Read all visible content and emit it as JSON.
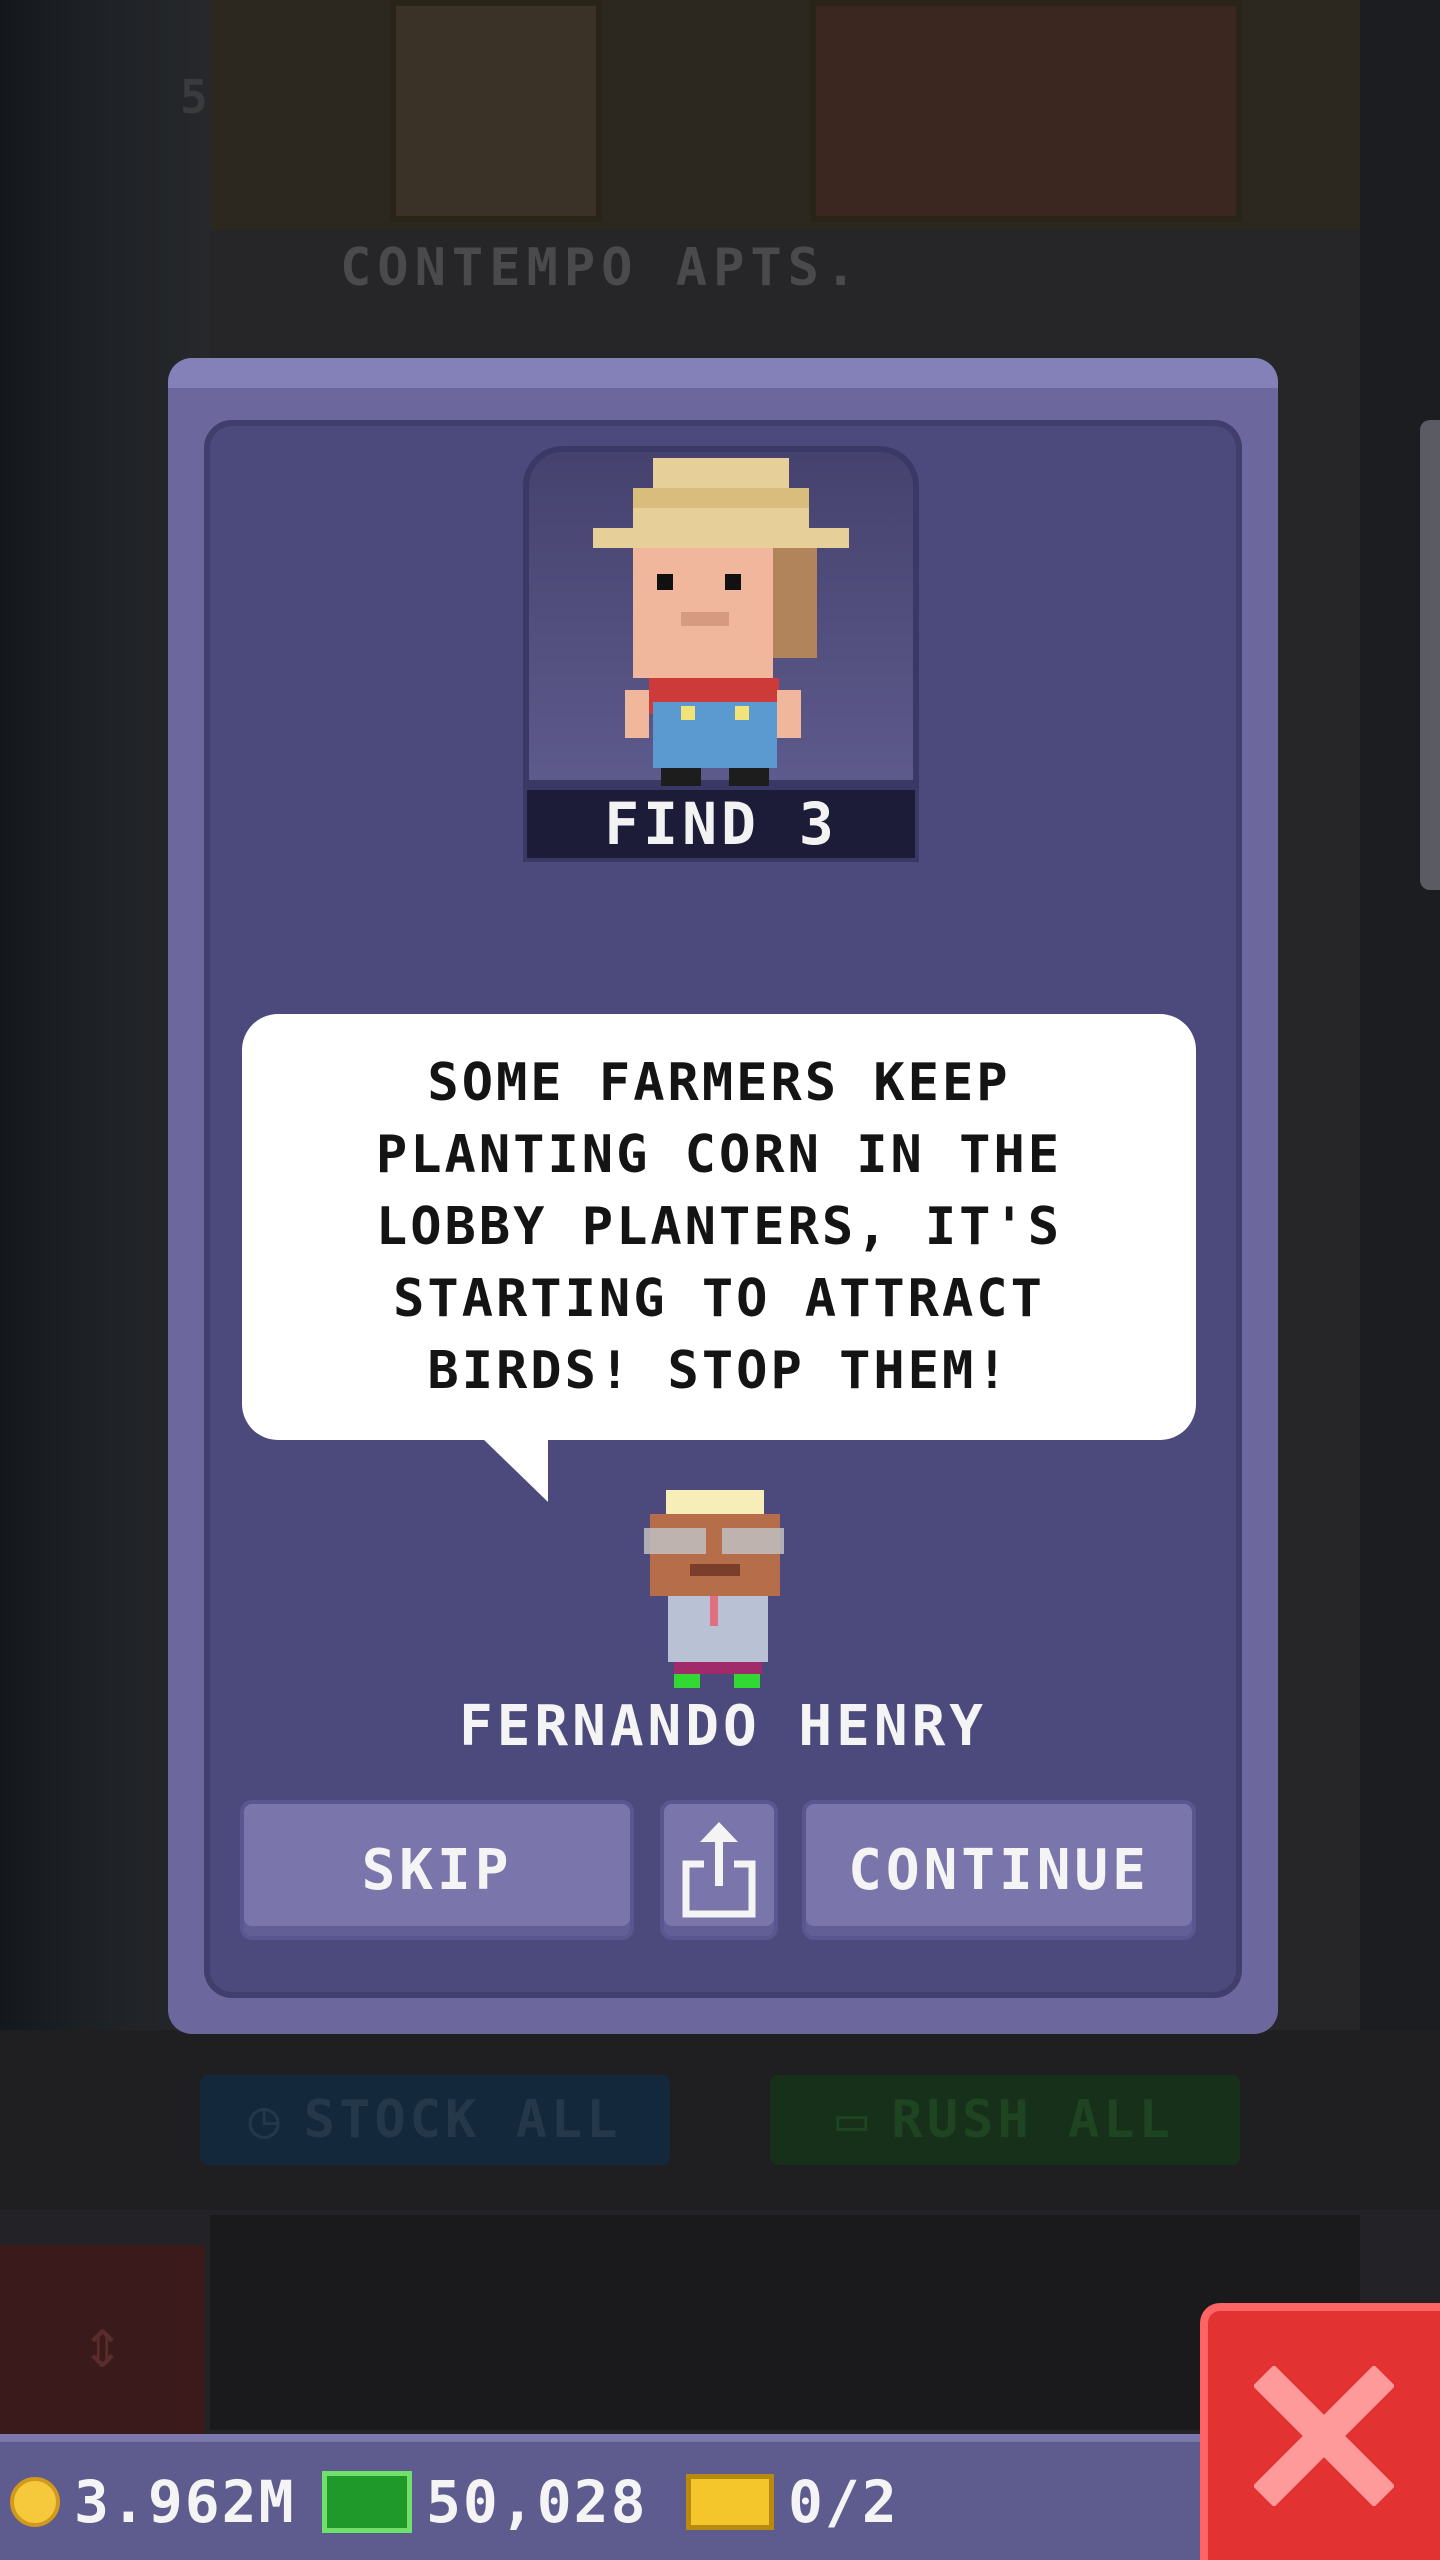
{
  "background": {
    "floor_number": "5",
    "floor_sign": "CONTEMPO APTS.",
    "stock_all_label": "STOCK ALL",
    "rush_all_label": "RUSH ALL"
  },
  "dialog": {
    "mission_label": "FIND 3",
    "speech": "SOME FARMERS KEEP PLANTING CORN IN THE LOBBY PLANTERS, IT'S STARTING TO ATTRACT BIRDS! STOP THEM!",
    "speaker_name": "FERNANDO HENRY",
    "skip_label": "SKIP",
    "continue_label": "CONTINUE",
    "share_icon": "share-icon"
  },
  "hud": {
    "coins": "3.962M",
    "bux": "50,028",
    "tickets": "0/2"
  },
  "colors": {
    "dialog_outer": "#6c689e",
    "dialog_inner": "#4c4a7c",
    "button": "#7a76ac",
    "close_button": "#e23232"
  }
}
